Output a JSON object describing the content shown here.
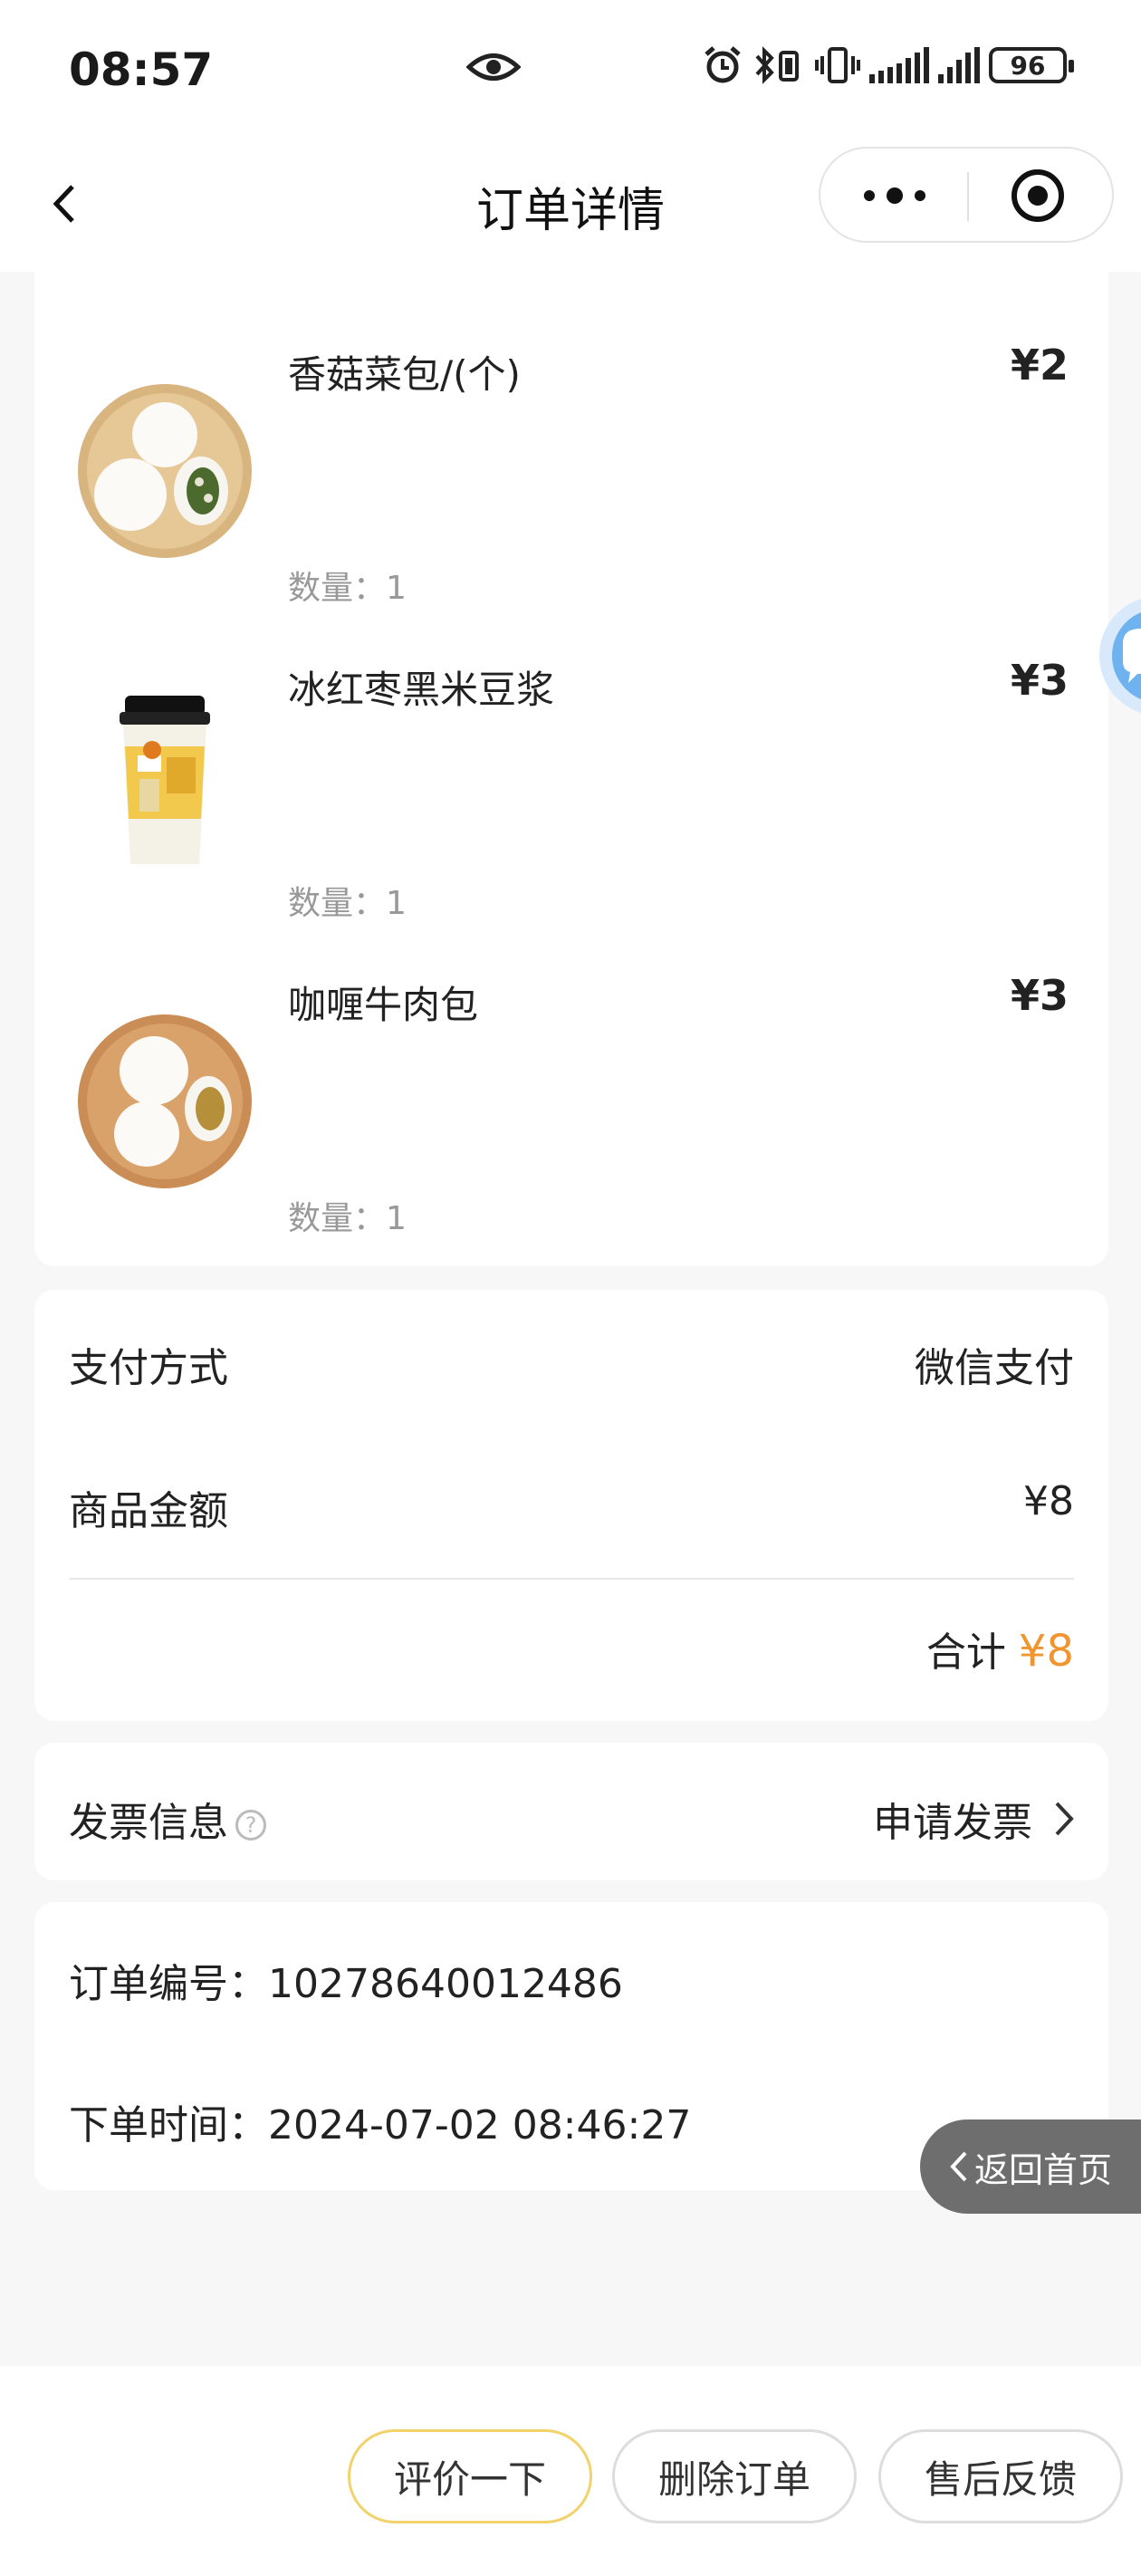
{
  "status_bar": {
    "time": "08:57",
    "battery": "96",
    "icons": [
      "eye-icon",
      "alarm-icon",
      "bluetooth-icon",
      "vibrate-icon",
      "signal-icon",
      "signal-icon",
      "battery-icon"
    ]
  },
  "nav": {
    "title": "订单详情",
    "icons": [
      "back-icon",
      "more-icon",
      "target-icon"
    ]
  },
  "items": [
    {
      "name": "香菇菜包/(个)",
      "price": "¥2",
      "qty_label": "数量：",
      "qty": "1",
      "image": "mushroom-bun"
    },
    {
      "name": "冰红枣黑米豆浆",
      "price": "¥3",
      "qty_label": "数量：",
      "qty": "1",
      "image": "soy-milk-cup"
    },
    {
      "name": "咖喱牛肉包",
      "price": "¥3",
      "qty_label": "数量：",
      "qty": "1",
      "image": "curry-beef-bun"
    }
  ],
  "payment": {
    "method_label": "支付方式",
    "method_value": "微信支付",
    "amount_label": "商品金额",
    "amount_value": "¥8",
    "total_label": "合计",
    "total_value": "¥8"
  },
  "invoice": {
    "label": "发票信息",
    "action": "申请发票"
  },
  "order": {
    "number_label": "订单编号：",
    "number": "10278640012486",
    "time_label": "下单时间：",
    "time": "2024-07-02 08:46:27"
  },
  "home_button": "返回首页",
  "actions": {
    "review": "评价一下",
    "delete": "删除订单",
    "after_sale": "售后反馈"
  },
  "colors": {
    "accent": "#f0952f",
    "review_border": "#f2d36b",
    "home_button_bg": "#6e6e6e"
  }
}
